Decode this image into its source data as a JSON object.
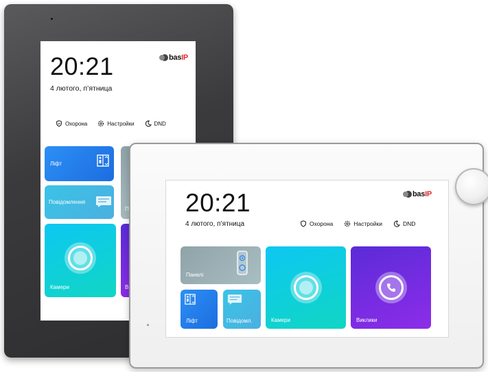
{
  "brand": {
    "logo_text": "bas",
    "logo_accent": "IP",
    "accent_color": "#e22a2a"
  },
  "dark_panel": {
    "time": "20:21",
    "date": "4 лютого, п’ятница",
    "status": {
      "security": "Охорона",
      "settings": "Настройки",
      "dnd": "DND"
    },
    "tiles": {
      "lift": "Ліфт",
      "messages": "Повідомлення",
      "cameras": "Камери",
      "calls_partial": "Ви",
      "panels_partial": "П"
    }
  },
  "white_panel": {
    "time": "20:21",
    "date": "4 лютого, п’ятница",
    "status": {
      "security": "Охорона",
      "settings": "Настройки",
      "dnd": "DND"
    },
    "tiles": {
      "panels": "Панелі",
      "lift": "Ліфт",
      "messages": "Повідомл.",
      "cameras": "Камери",
      "calls": "Виклики"
    }
  },
  "icons": [
    "shield-icon",
    "gear-icon",
    "moon-icon",
    "elevator-icon",
    "message-icon",
    "camera-icon",
    "phone-icon",
    "intercom-panel-icon"
  ]
}
